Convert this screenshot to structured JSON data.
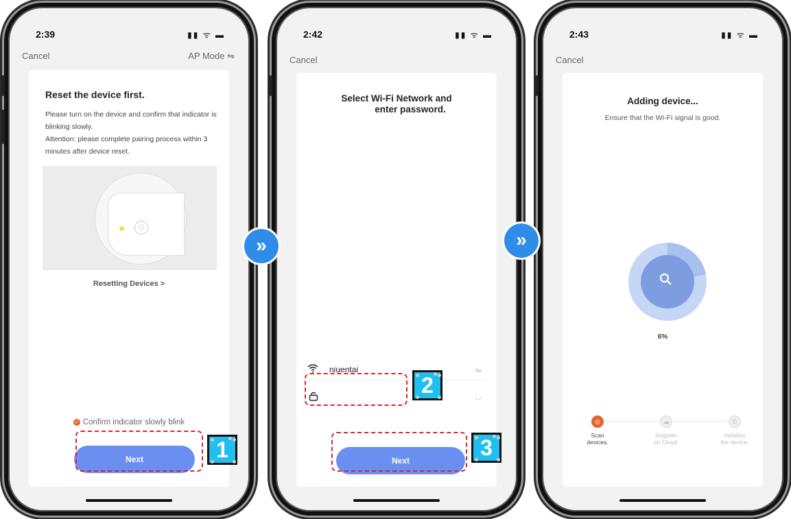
{
  "phone1": {
    "time": "2:39",
    "status_icons": "▮▮ ᯤ ▬",
    "cancel": "Cancel",
    "ap_mode": "AP Mode ⇋",
    "title": "Reset the device first.",
    "desc_1": "Please turn on the device and confirm that indicator is blinking slowly.",
    "desc_2": "Attention: please complete pairing process within 3 minutes after device reset.",
    "resetting_link": "Resetting Devices >",
    "confirm_text": "Confirm indicator slowly blink",
    "next": "Next"
  },
  "phone2": {
    "time": "2:42",
    "status_icons": "▮▮ ᯤ ▬",
    "cancel": "Cancel",
    "title_line1": "Select  Wi-Fi Network and",
    "title_line2": "enter password.",
    "ssid": "niuentai",
    "password_value": "",
    "next": "Next"
  },
  "phone3": {
    "time": "2:43",
    "status_icons": "▮▮ ᯤ ▬",
    "cancel": "Cancel",
    "title": "Adding device...",
    "subtitle": "Ensure that the Wi-Fi signal is good.",
    "progress_percent": "6%",
    "steps": [
      {
        "line1": "Scan",
        "line2": "devices."
      },
      {
        "line1": "Register",
        "line2": "on Cloud."
      },
      {
        "line1": "Initialize",
        "line2": "the device."
      }
    ]
  },
  "callouts": [
    "1",
    "2",
    "3"
  ],
  "arrows": [
    "»",
    "»"
  ],
  "colors": {
    "accent_button": "#6b8ff0",
    "callout_bg": "#1fc0ef",
    "dash_outline": "#d9232a",
    "arrow_bg": "#2f8ce8",
    "active_step": "#e8632d"
  }
}
